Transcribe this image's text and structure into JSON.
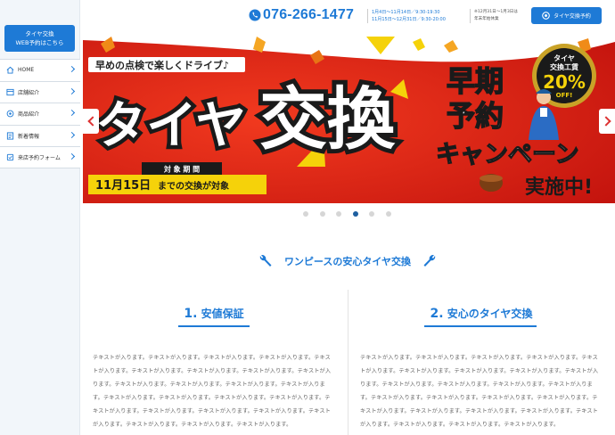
{
  "sidebar": {
    "cta_line1": "タイヤ交換",
    "cta_line2": "WEB予約はこちら",
    "items": [
      {
        "label": "HOME",
        "icon": "home-icon"
      },
      {
        "label": "店舗紹介",
        "icon": "store-icon"
      },
      {
        "label": "商品紹介",
        "icon": "product-icon"
      },
      {
        "label": "新着情報",
        "icon": "news-icon"
      },
      {
        "label": "来店予約フォーム",
        "icon": "form-icon"
      }
    ]
  },
  "header": {
    "phone": "076-266-1477",
    "hours_line1": "1月4日〜11月14日／9:30-19:30",
    "hours_line2": "11月15日〜12月31日／9:30-20:00",
    "note_line1": "※12月31日〜1月3日は",
    "note_line2": "年末年始休業",
    "reserve_button": "タイヤ交換予約"
  },
  "banner": {
    "tagline": "早めの点検で楽しくドライブ♪",
    "main_text": "タイヤ",
    "main_text_big": "交換",
    "side_text_1": "早期",
    "side_text_2": "予約",
    "side_text_3": "キャンペーン",
    "side_text_4": "実施中!",
    "badge_line1": "タイヤ",
    "badge_line2": "交換工賃",
    "badge_pct": "20%",
    "badge_off": "OFF!",
    "period_label": "対 象 期 間",
    "period_text_1": "11月15日",
    "period_text_2": "までの交換が対象",
    "slide_count": 6,
    "active_slide": 4,
    "colors": {
      "red": "#d9231b",
      "yellow": "#f5d20a",
      "blue": "#1e7ad6"
    }
  },
  "section": {
    "title": "ワンピースの安心タイヤ交換",
    "columns": [
      {
        "num": "1.",
        "heading": "安値保証"
      },
      {
        "num": "2.",
        "heading": "安心のタイヤ交換"
      }
    ],
    "placeholder_text": "テキストが入ります。テキストが入ります。テキストが入ります。テキストが入ります。テキストが入ります。テキストが入ります。テキストが入ります。テキストが入ります。テキストが入ります。テキストが入ります。テキストが入ります。テキストが入ります。テキストが入ります。テキストが入ります。テキストが入ります。テキストが入ります。テキストが入ります。テキストが入ります。テキストが入ります。テキストが入ります。テキストが入ります。テキストが入ります。テキストが入ります。テキストが入ります。テキストが入ります。"
  }
}
